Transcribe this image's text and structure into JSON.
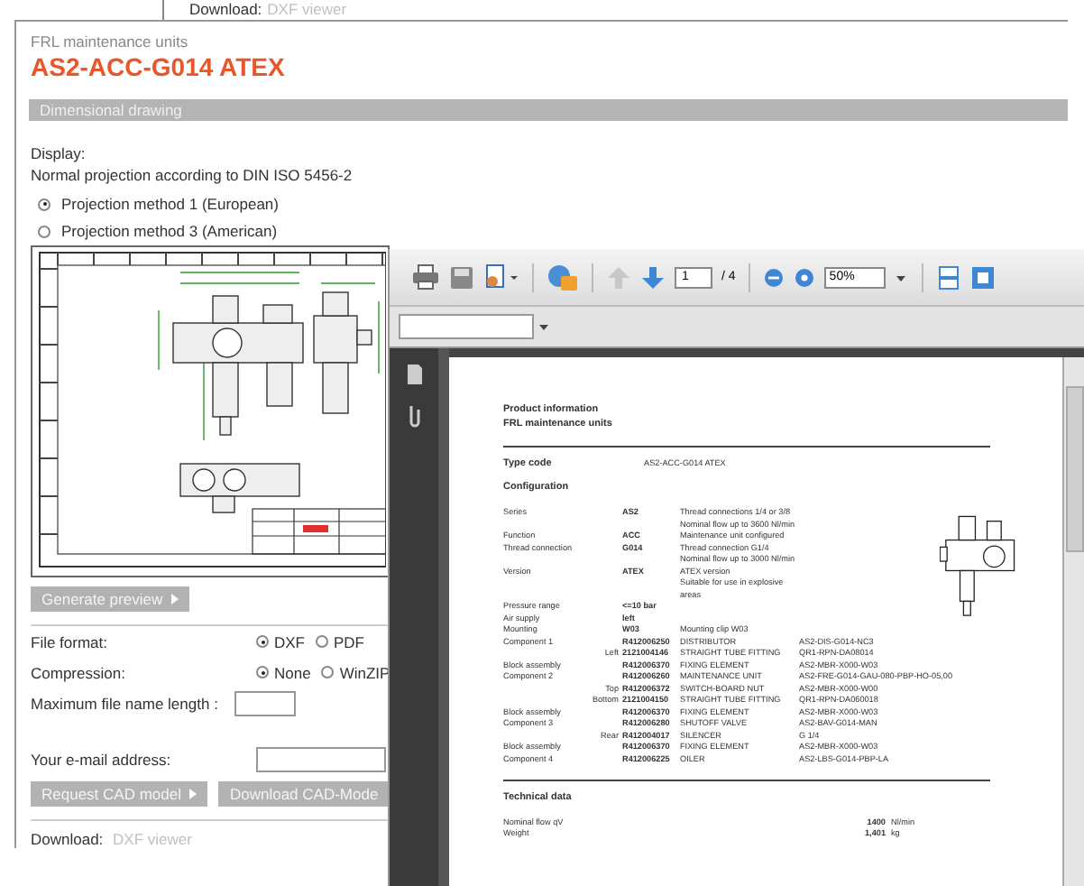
{
  "top_download": {
    "label": "Download:",
    "link": "DXF viewer"
  },
  "panel": {
    "category": "FRL maintenance units",
    "title": "AS2-ACC-G014 ATEX",
    "section": "Dimensional drawing",
    "display_label": "Display:",
    "display_note": "Normal projection according to DIN ISO 5456-2",
    "projections": [
      {
        "label": "Projection method 1 (European)",
        "selected": true
      },
      {
        "label": "Projection method 3 (American)",
        "selected": false
      }
    ],
    "preview_button": "Generate preview",
    "file_format": {
      "label": "File format:",
      "options": [
        {
          "label": "DXF",
          "selected": true
        },
        {
          "label": "PDF",
          "selected": false
        }
      ]
    },
    "compression": {
      "label": "Compression:",
      "options": [
        {
          "label": "None",
          "selected": true
        },
        {
          "label": "WinZIP",
          "selected": false
        }
      ]
    },
    "max_name": {
      "label": "Maximum file name length :"
    },
    "email": {
      "label": "Your e-mail address:"
    },
    "buttons": [
      "Request CAD model",
      "Download CAD-Mode"
    ],
    "download": {
      "label": "Download:",
      "link": "DXF viewer"
    }
  },
  "viewer": {
    "page": "1",
    "page_count": "/ 4",
    "zoom": "50%",
    "document": {
      "heading": "Product information",
      "subheading": "FRL maintenance units",
      "type_label": "Type code",
      "type_value": "AS2-ACC-G014 ATEX",
      "config_title": "Configuration",
      "rows": [
        {
          "label": "Series",
          "side": "",
          "code": "AS2",
          "desc": [
            "Thread connections 1/4 or 3/8",
            "Nominal flow up to 3600 Nl/min"
          ],
          "part": ""
        },
        {
          "label": "Function",
          "side": "",
          "code": "ACC",
          "desc": [
            "Maintenance unit configured"
          ],
          "part": ""
        },
        {
          "label": "Thread connection",
          "side": "",
          "code": "G014",
          "desc": [
            "Thread connection G1/4",
            "Nominal flow up to 3000 Nl/min"
          ],
          "part": ""
        },
        {
          "label": "Version",
          "side": "",
          "code": "ATEX",
          "desc": [
            "ATEX version",
            "Suitable for use in explosive areas"
          ],
          "part": ""
        },
        {
          "label": "Pressure range",
          "side": "",
          "code": "<=10 bar",
          "desc": [],
          "part": ""
        },
        {
          "label": "Air supply",
          "side": "",
          "code": "left",
          "desc": [],
          "part": ""
        },
        {
          "label": "Mounting",
          "side": "",
          "code": "W03",
          "desc": [
            "Mounting clip W03"
          ],
          "part": ""
        },
        {
          "label": "Component 1",
          "side": "",
          "code": "R412006250",
          "desc": [
            "DISTRIBUTOR"
          ],
          "part": "AS2-DIS-G014-NC3"
        },
        {
          "label": "",
          "side": "Left",
          "code": "2121004146",
          "desc": [
            "STRAIGHT TUBE FITTING"
          ],
          "part": "QR1-RPN-DA08014"
        },
        {
          "label": "Block assembly",
          "side": "",
          "code": "R412006370",
          "desc": [
            "FIXING ELEMENT"
          ],
          "part": "AS2-MBR-X000-W03"
        },
        {
          "label": "Component 2",
          "side": "",
          "code": "R412006260",
          "desc": [
            "MAINTENANCE UNIT"
          ],
          "part": "AS2-FRE-G014-GAU-080-PBP-HO-05,00"
        },
        {
          "label": "",
          "side": "Top",
          "code": "R412006372",
          "desc": [
            "SWITCH-BOARD NUT"
          ],
          "part": "AS2-MBR-X000-W00"
        },
        {
          "label": "",
          "side": "Bottom",
          "code": "2121004150",
          "desc": [
            "STRAIGHT TUBE FITTING"
          ],
          "part": "QR1-RPN-DA060018"
        },
        {
          "label": "Block assembly",
          "side": "",
          "code": "R412006370",
          "desc": [
            "FIXING ELEMENT"
          ],
          "part": "AS2-MBR-X000-W03"
        },
        {
          "label": "Component 3",
          "side": "",
          "code": "R412006280",
          "desc": [
            "SHUTOFF VALVE"
          ],
          "part": "AS2-BAV-G014-MAN"
        },
        {
          "label": "",
          "side": "Rear",
          "code": "R412004017",
          "desc": [
            "SILENCER"
          ],
          "part": "G 1/4"
        },
        {
          "label": "Block assembly",
          "side": "",
          "code": "R412006370",
          "desc": [
            "FIXING ELEMENT"
          ],
          "part": "AS2-MBR-X000-W03"
        },
        {
          "label": "Component 4",
          "side": "",
          "code": "R412006225",
          "desc": [
            "OILER"
          ],
          "part": "AS2-LBS-G014-PBP-LA"
        }
      ],
      "tech_title": "Technical data",
      "tech_rows": [
        {
          "label": "Nominal flow qV",
          "value": "1400",
          "unit": "Nl/min"
        },
        {
          "label": "Weight",
          "value": "1,401",
          "unit": "kg"
        }
      ]
    }
  }
}
